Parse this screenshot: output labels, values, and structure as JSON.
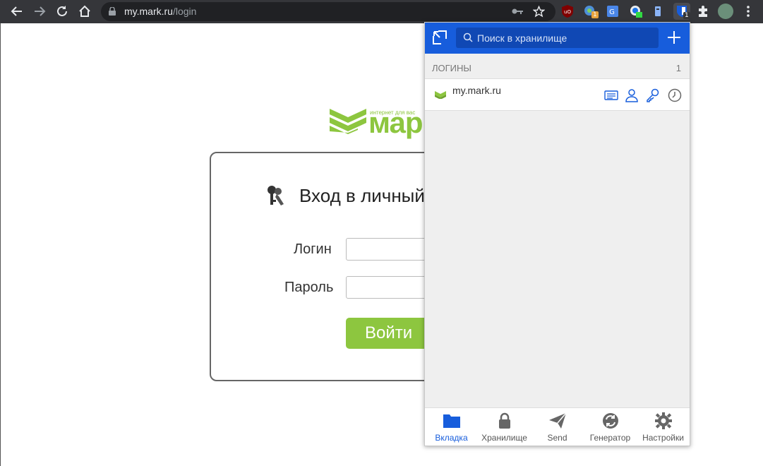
{
  "browser": {
    "url_host": "my.mark.ru",
    "url_path": "/login",
    "extension_badges": {
      "ext2": "1",
      "bitwarden": "1"
    }
  },
  "page": {
    "logo_tagline": "интернет для вас",
    "logo_text": "марк",
    "login_title": "Вход в личный кабинет",
    "login_label": "Логин",
    "password_label": "Пароль",
    "submit_label": "Войти"
  },
  "bitwarden": {
    "accent_color": "#175ddc",
    "search_placeholder": "Поиск в хранилище",
    "section_title": "ЛОГИНЫ",
    "section_count": "1",
    "items": [
      {
        "name": "my.mark.ru"
      }
    ],
    "nav": [
      {
        "label": "Вкладка",
        "icon": "folder-icon",
        "active": true
      },
      {
        "label": "Хранилище",
        "icon": "lock-icon",
        "active": false
      },
      {
        "label": "Send",
        "icon": "send-icon",
        "active": false
      },
      {
        "label": "Генератор",
        "icon": "generator-icon",
        "active": false
      },
      {
        "label": "Настройки",
        "icon": "gear-icon",
        "active": false
      }
    ]
  }
}
